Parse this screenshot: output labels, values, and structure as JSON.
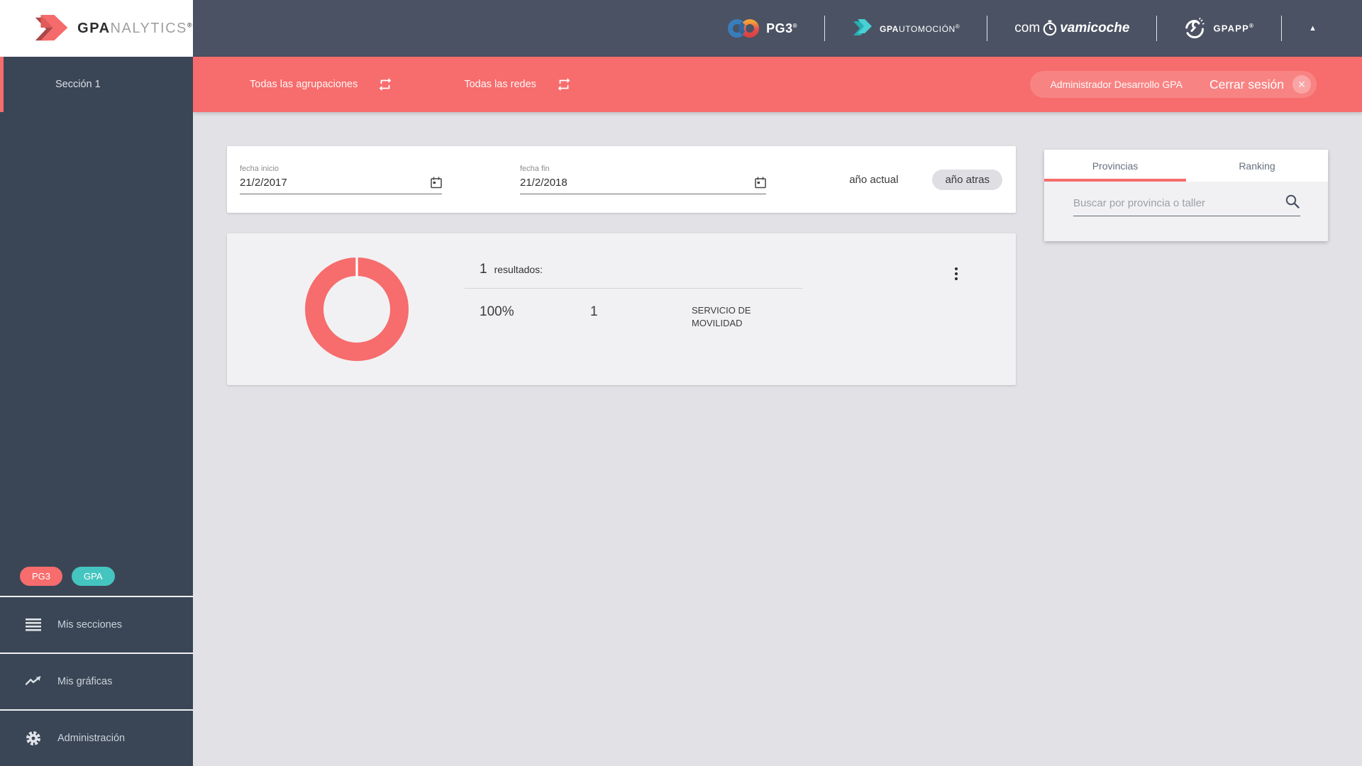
{
  "brand": {
    "bold": "GPA",
    "light": "NALYTICS",
    "registered": "®"
  },
  "header": {
    "pg3_label": "PG3",
    "gpautomocion_bold": "GPA",
    "gpautomocion_rest": "UTOMOCIÓN",
    "comovamicoche_pre": "com",
    "comovamicoche_post": "vamicoche",
    "gpapp_label": "GPAPP",
    "registered": "®",
    "collapse_icon": "▲"
  },
  "filter_bar": {
    "agrupaciones_label": "Todas las agrupaciones",
    "redes_label": "Todas las redes",
    "user_name": "Administrador Desarrollo GPA",
    "logout_label": "Cerrar sesión",
    "close_glyph": "✕"
  },
  "sidebar": {
    "section_item": "Sección 1",
    "badges": [
      {
        "label": "PG3",
        "color": "#f76c6c"
      },
      {
        "label": "GPA",
        "color": "#45c5bf"
      }
    ],
    "menu": [
      {
        "label": "Mis secciones"
      },
      {
        "label": "Mis gráficas"
      },
      {
        "label": "Administración"
      }
    ]
  },
  "date_filters": {
    "start": {
      "label": "fecha inicio",
      "value": "21/2/2017"
    },
    "end": {
      "label": "fecha fin",
      "value": "21/2/2018"
    },
    "current_year_label": "año actual",
    "previous_year_label": "año atras"
  },
  "chart_data": {
    "type": "pie",
    "title": "",
    "results_count": "1",
    "results_label": "resultados:",
    "categories": [
      "SERVICIO DE MOVILIDAD"
    ],
    "values": [
      100
    ],
    "counts": [
      1
    ],
    "colors": [
      "#f76c6c"
    ],
    "legend_position": "right-table",
    "table": {
      "rows": [
        {
          "percent": "100%",
          "count": "1",
          "label": "SERVICIO DE MOVILIDAD"
        }
      ]
    }
  },
  "right_panel": {
    "tabs": [
      {
        "label": "Provincias"
      },
      {
        "label": "Ranking"
      }
    ],
    "search_placeholder": "Buscar por provincia o taller"
  },
  "colors": {
    "accent": "#f76c6c",
    "teal": "#45c5bf",
    "header_bg": "#4a5263",
    "sidebar_bg": "#3a4656",
    "page_bg": "#e2e2e6",
    "card_bg": "#f1f1f3"
  }
}
